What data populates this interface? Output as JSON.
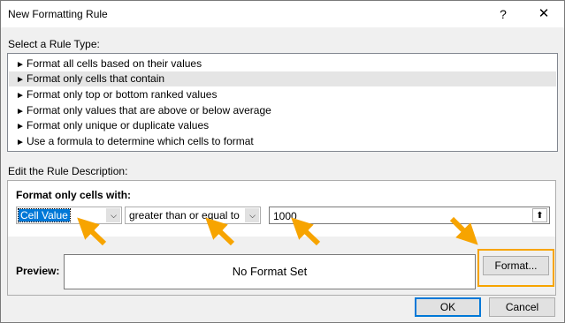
{
  "window": {
    "title": "New Formatting Rule",
    "help_label": "?",
    "close_label": "✕"
  },
  "rule_type": {
    "heading": "Select a Rule Type:",
    "items": [
      {
        "label": "Format all cells based on their values"
      },
      {
        "label": "Format only cells that contain",
        "selected": true
      },
      {
        "label": "Format only top or bottom ranked values"
      },
      {
        "label": "Format only values that are above or below average"
      },
      {
        "label": "Format only unique or duplicate values"
      },
      {
        "label": "Use a formula to determine which cells to format"
      }
    ]
  },
  "description": {
    "heading": "Edit the Rule Description:",
    "format_label": "Format only cells with:",
    "condition_type": "Cell Value",
    "operator": "greater than or equal to",
    "value": "1000",
    "preview_label": "Preview:",
    "preview_text": "No Format Set",
    "format_button": "Format..."
  },
  "footer": {
    "ok_label": "OK",
    "cancel_label": "Cancel"
  },
  "colors": {
    "annotation_arrow": "#f7a400",
    "selection": "#0078d7"
  }
}
